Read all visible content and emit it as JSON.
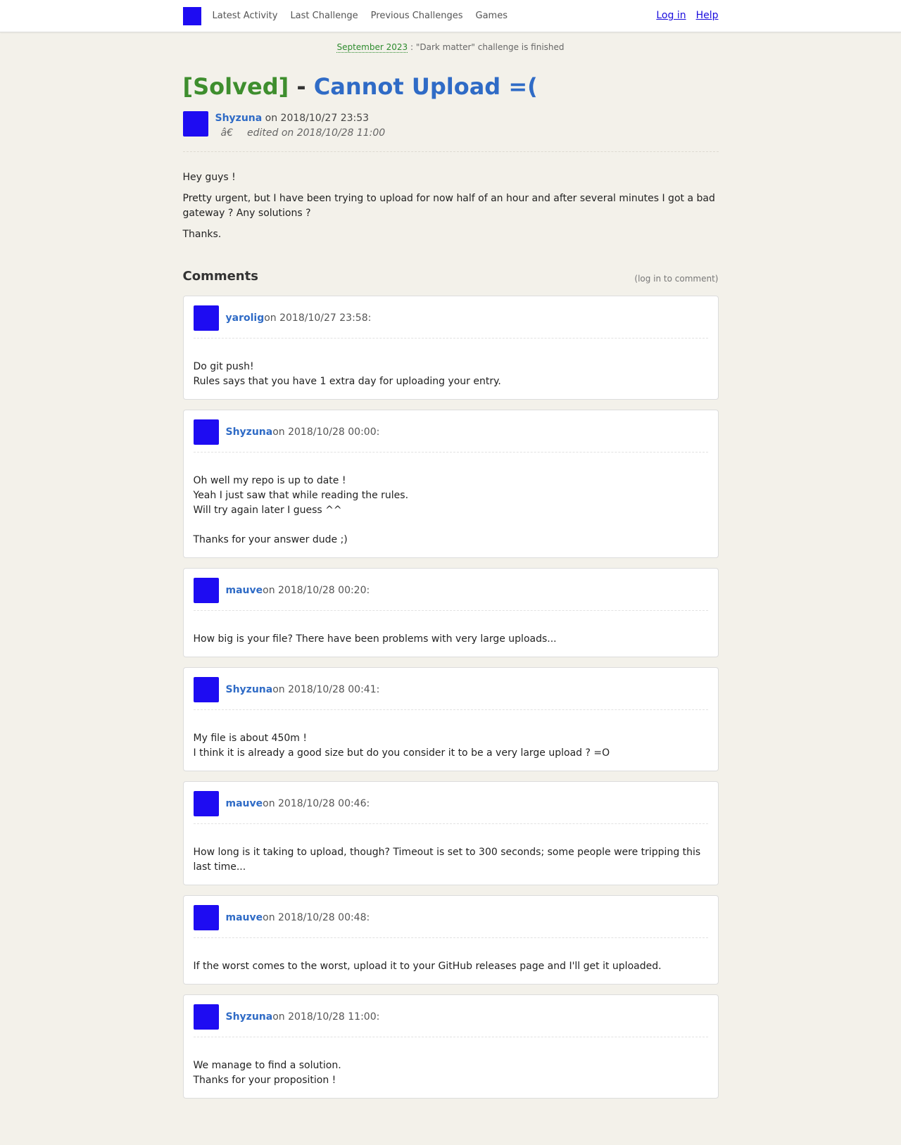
{
  "nav": {
    "items": [
      "Latest Activity",
      "Last Challenge",
      "Previous Challenges",
      "Games"
    ],
    "login": "Log in",
    "help": "Help"
  },
  "announcement": {
    "date_link": "September 2023",
    "text": " : \"Dark matter\" challenge is finished"
  },
  "post": {
    "status": "[Solved]",
    "dash": " - ",
    "title": "Cannot Upload =(",
    "author": "Shyzuna",
    "posted": " on 2018/10/27 23:53",
    "edited_glyph": "â€",
    "edited": "edited on 2018/10/28 11:00",
    "body": [
      "Hey guys !",
      "Pretty urgent, but I have been trying to upload for now half of an hour and after several minutes I got a bad gateway ? Any solutions ?",
      "Thanks."
    ]
  },
  "comments_section": {
    "heading": "Comments",
    "login_note": "(log in to comment)"
  },
  "comments": [
    {
      "author": "yarolig",
      "date": " on 2018/10/27 23:58:",
      "lines": [
        "Do git push!",
        "Rules says that you have 1 extra day for uploading your entry."
      ]
    },
    {
      "author": "Shyzuna",
      "date": " on 2018/10/28 00:00:",
      "lines": [
        "Oh well my repo is up to date !",
        "Yeah I just saw that while reading the rules.",
        "Will try again later I guess ^^",
        "",
        "Thanks for your answer dude ;)"
      ]
    },
    {
      "author": "mauve",
      "date": " on 2018/10/28 00:20:",
      "lines": [
        "How big is your file? There have been problems with very large uploads..."
      ]
    },
    {
      "author": "Shyzuna",
      "date": " on 2018/10/28 00:41:",
      "lines": [
        "My file is about 450m !",
        "I think it is already a good size but do you consider it to be a very large upload ? =O"
      ]
    },
    {
      "author": "mauve",
      "date": " on 2018/10/28 00:46:",
      "lines": [
        "How long is it taking to upload, though? Timeout is set to 300 seconds; some people were tripping this last time..."
      ]
    },
    {
      "author": "mauve",
      "date": " on 2018/10/28 00:48:",
      "lines": [
        "If the worst comes to the worst, upload it to your GitHub releases page and I'll get it uploaded."
      ]
    },
    {
      "author": "Shyzuna",
      "date": " on 2018/10/28 11:00:",
      "lines": [
        "We manage to find a solution.",
        "Thanks for your proposition !"
      ]
    }
  ],
  "colors": {
    "background": "#f3f1ea",
    "avatar": "#1e0cf2",
    "solved": "#3e8e2e",
    "link_blue": "#2f6bc6",
    "nav_link": "#1a0dde"
  }
}
